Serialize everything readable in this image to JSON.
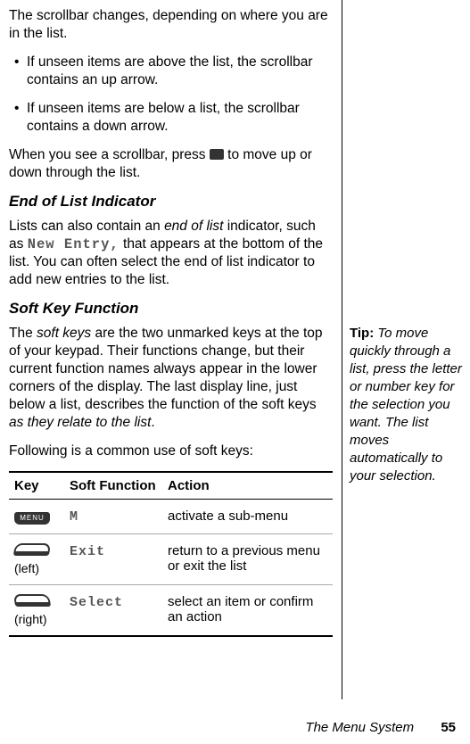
{
  "main": {
    "p1": "The scrollbar changes, depending on where you are in the list.",
    "b1": "If unseen items are above the list, the scrollbar contains an up arrow.",
    "b2": "If unseen items are below a list, the scrollbar contains a down arrow.",
    "p2a": "When you see a scrollbar, press ",
    "p2b": " to move up or down through the list.",
    "h_eol": "End of List Indicator",
    "eol_a": "Lists can also contain an ",
    "eol_b": "end of list",
    "eol_c": " indicator, such as ",
    "eol_d": "New Entry,",
    "eol_e": " that appears at the bottom of the list. You can often select the end of list indicator to add new entries to the list.",
    "h_sk": "Soft Key Function",
    "sk_a": "The ",
    "sk_b": "soft keys",
    "sk_c": " are the two unmarked keys at the top of your keypad. Their functions change, but their current function names always appear in the lower corners of the display. The last display line, just below a list, describes the function of the soft keys ",
    "sk_d": "as they relate to the list",
    "sk_e": ".",
    "p3": "Following is a common use of soft keys:"
  },
  "table": {
    "h1": "Key",
    "h2": "Soft Function",
    "h3": "Action",
    "r1": {
      "menuText": "MENU",
      "fn": "M",
      "act": "activate a sub-menu"
    },
    "r2": {
      "lbl": "(left)",
      "fn": "Exit",
      "act": "return to a previous menu or exit the list"
    },
    "r3": {
      "lbl": "(right)",
      "fn": "Select",
      "act": "select an item or confirm an action"
    }
  },
  "tip": {
    "label": "Tip: ",
    "text": "To move quickly through a list, press the letter or number key for the selection you want. The list moves automatically to your selection."
  },
  "footer": {
    "section": "The Menu System",
    "page": "55"
  }
}
